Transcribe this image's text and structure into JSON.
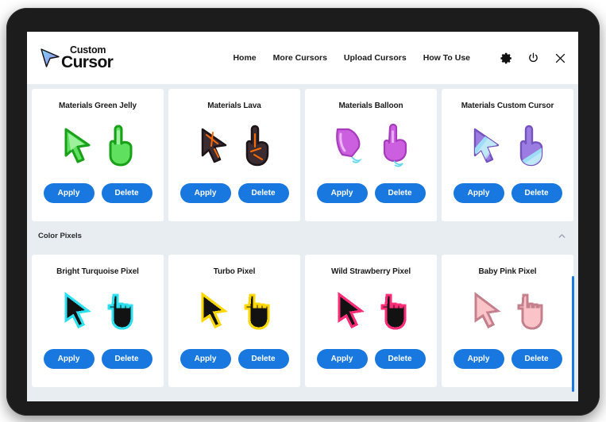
{
  "app": {
    "logo_top": "Custom",
    "logo_bottom": "Cursor",
    "accent_blue": "#1878e0",
    "background": "#e7edf1"
  },
  "nav": {
    "links": [
      {
        "label": "Home",
        "name": "nav-home"
      },
      {
        "label": "More Cursors",
        "name": "nav-more-cursors"
      },
      {
        "label": "Upload Cursors",
        "name": "nav-upload-cursors"
      },
      {
        "label": "How To Use",
        "name": "nav-how-to-use"
      }
    ],
    "icons": [
      {
        "name": "gear-icon",
        "label": "Settings"
      },
      {
        "name": "power-icon",
        "label": "Power"
      },
      {
        "name": "close-icon",
        "label": "Close"
      }
    ]
  },
  "buttons": {
    "apply": "Apply",
    "delete": "Delete"
  },
  "sections": [
    {
      "id": "materials",
      "header_visible": false,
      "title": "Materials",
      "cards": [
        {
          "title": "Materials Green Jelly",
          "style": "jelly",
          "fill": "#4fdc4f",
          "fill2": "#9af59a",
          "stroke": "#1fa81f"
        },
        {
          "title": "Materials Lava",
          "style": "lava",
          "fill": "#4a3840",
          "fill2": "#2b2026",
          "stroke": "#ff6a00"
        },
        {
          "title": "Materials Balloon",
          "style": "balloon",
          "fill": "#cc5ee0",
          "fill2": "#e49bf0",
          "stroke": "#a93fc0"
        },
        {
          "title": "Materials Custom Cursor",
          "style": "striped",
          "fill": "#9b7ce0",
          "fill2": "#b9a2ef",
          "stroke": "#7b5ec8"
        }
      ]
    },
    {
      "id": "color-pixels",
      "header_visible": true,
      "title": "Color Pixels",
      "collapse_icon": "chevron-up-icon",
      "cards": [
        {
          "title": "Bright Turquoise Pixel",
          "style": "pixel",
          "fill": "#121212",
          "stroke": "#2ce0ef"
        },
        {
          "title": "Turbo Pixel",
          "style": "pixel",
          "fill": "#121212",
          "stroke": "#ffd700"
        },
        {
          "title": "Wild Strawberry Pixel",
          "style": "pixel",
          "fill": "#121212",
          "stroke": "#ff2d78"
        },
        {
          "title": "Baby Pink Pixel",
          "style": "pixel",
          "fill": "#fac3c8",
          "stroke": "#c4818d"
        }
      ]
    }
  ],
  "scrollbar": {
    "name": "vertical-scrollbar"
  }
}
